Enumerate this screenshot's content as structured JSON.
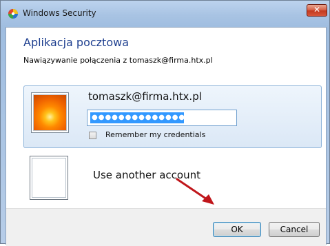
{
  "window": {
    "title": "Windows Security",
    "close_label": "✕"
  },
  "dialog": {
    "heading": "Aplikacja pocztowa",
    "subtext": "Nawiązywanie połączenia z tomaszk@firma.htx.pl"
  },
  "account": {
    "username": "tomaszk@firma.htx.pl",
    "password_masked": "●●●●●●●●●●●●●●●",
    "remember_label": "Remember my credentials",
    "remember_checked": false
  },
  "other_account": {
    "label": "Use another account"
  },
  "buttons": {
    "ok": "OK",
    "cancel": "Cancel"
  },
  "colors": {
    "heading": "#1e3f8f",
    "selection": "#3399ff",
    "annotation_arrow": "#c0161b"
  }
}
